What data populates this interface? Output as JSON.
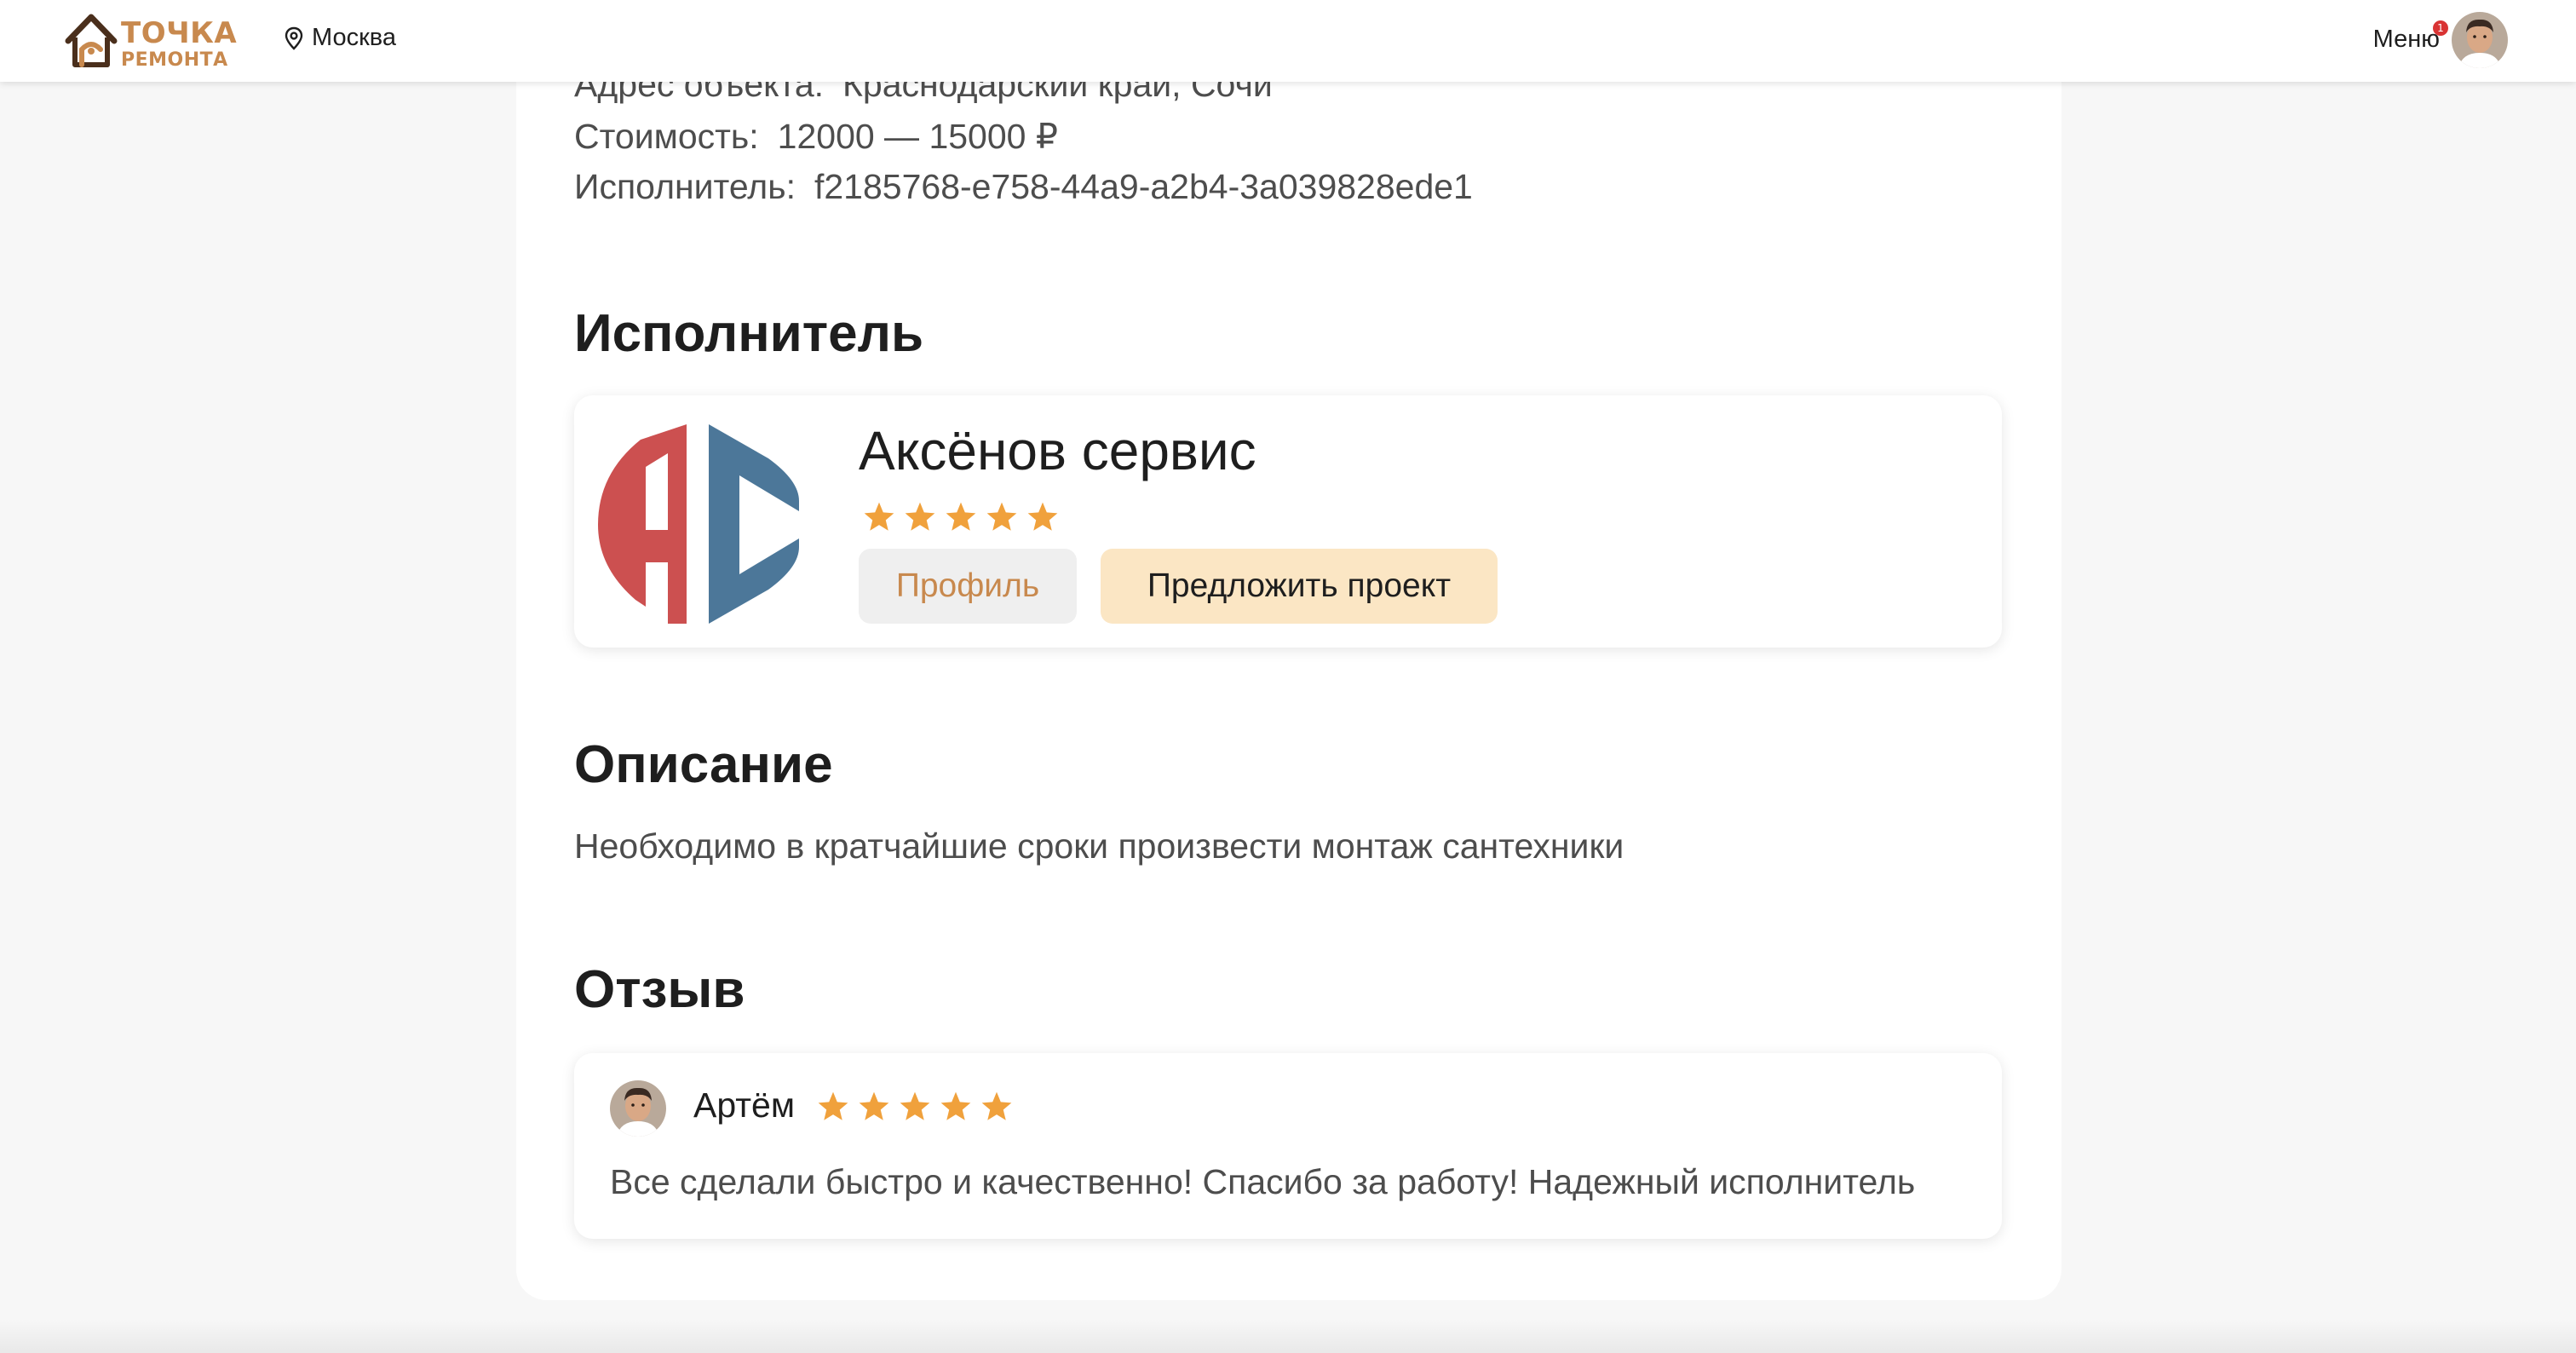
{
  "header": {
    "logo_line1": "ТОЧКА",
    "logo_line2": "РЕМОНТА",
    "city": "Москва",
    "menu_label": "Меню",
    "notification_count": "1",
    "brand_color": "#c8894e"
  },
  "order": {
    "address_label": "Адрес объекта:",
    "address_value": "Краснодарский край, Сочи",
    "price_label": "Стоимость:",
    "price_value": "12000 — 15000 ₽",
    "executor_label": "Исполнитель:",
    "executor_value": "f2185768-e758-44a9-a2b4-3a039828ede1"
  },
  "executor_section": {
    "title": "Исполнитель",
    "company_name": "Аксёнов сервис",
    "logo_text": "AC",
    "logo_colors": [
      "#cc5050",
      "#4c7799"
    ],
    "rating": 5,
    "profile_button": "Профиль",
    "propose_button": "Предложить проект"
  },
  "description_section": {
    "title": "Описание",
    "text": "Необходимо в кратчайшие сроки произвести монтаж сантехники"
  },
  "review_section": {
    "title": "Отзыв",
    "author": "Артём",
    "rating": 5,
    "text": "Все сделали быстро и качественно! Спасибо за работу! Надежный исполнитель"
  },
  "star_color": "#f0a13c"
}
